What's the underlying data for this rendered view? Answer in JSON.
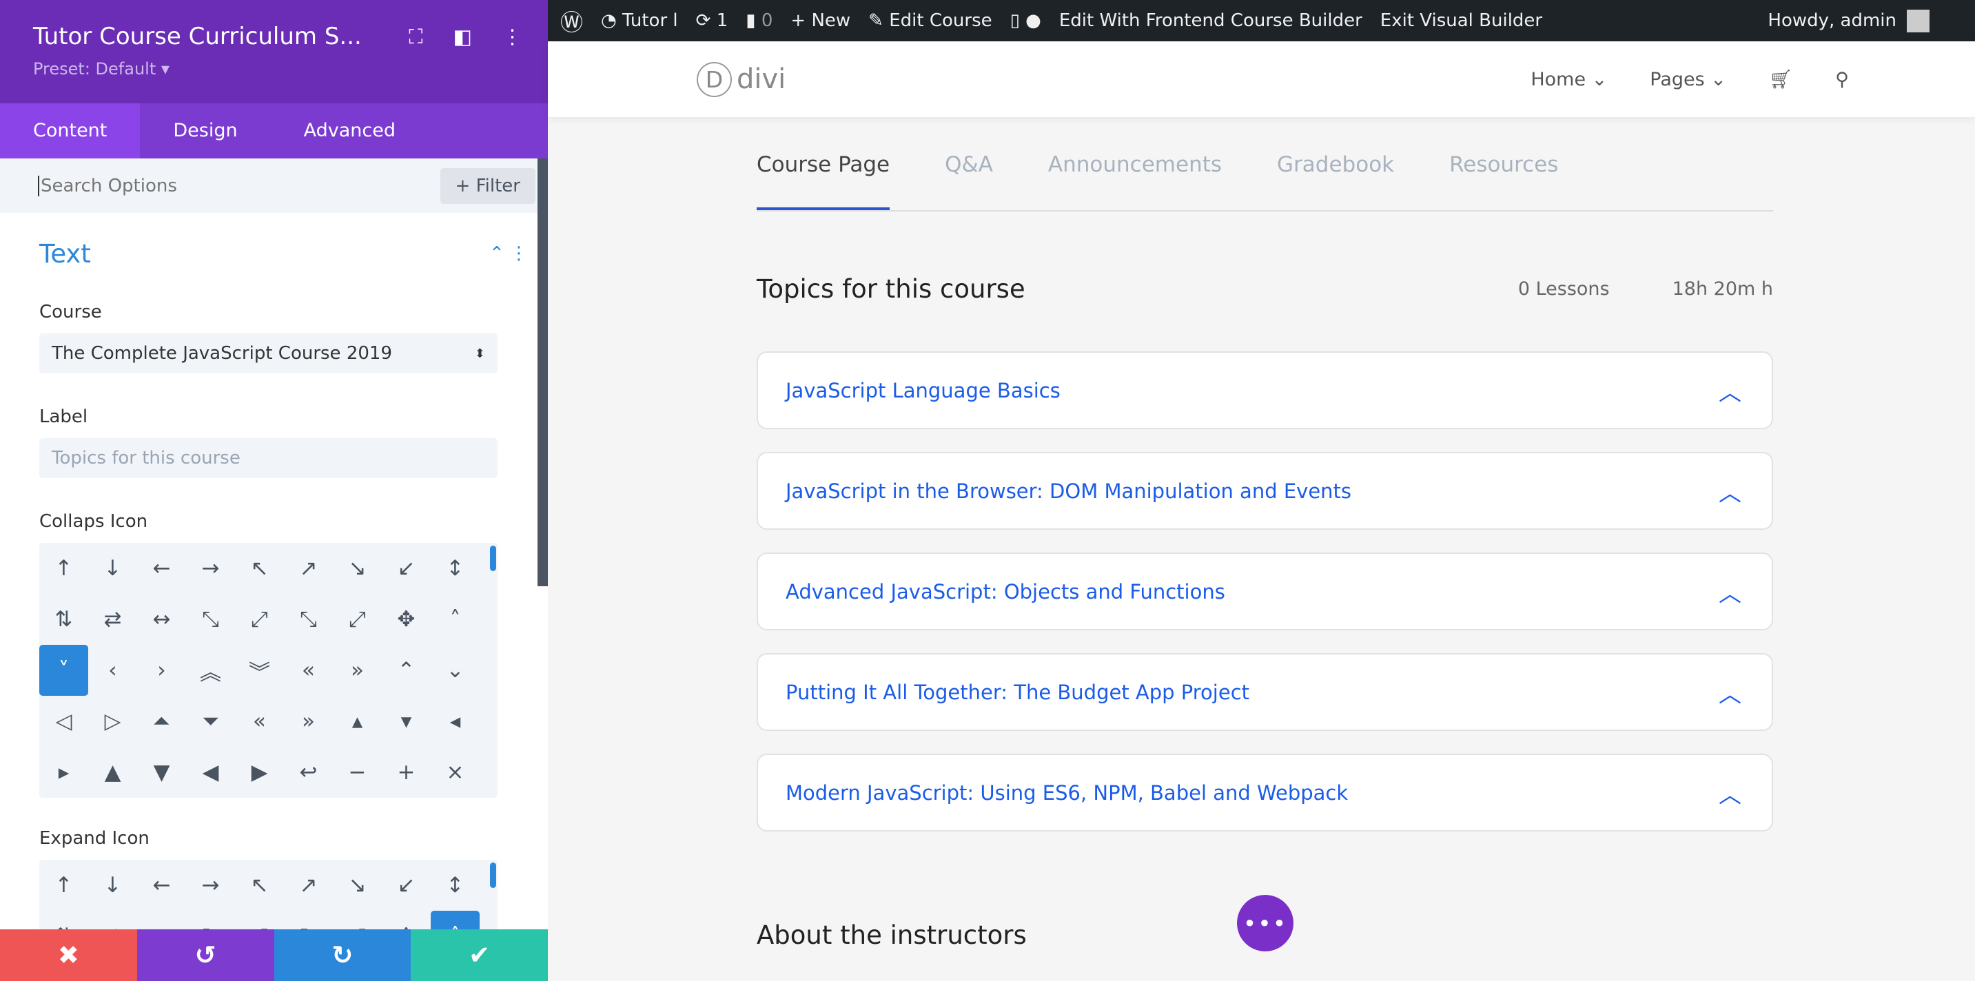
{
  "panel": {
    "title": "Tutor Course Curriculum S...",
    "preset": "Preset: Default ▾",
    "tabs": [
      "Content",
      "Design",
      "Advanced"
    ],
    "search_placeholder": "Search Options",
    "filter": "+ Filter",
    "section": "Text",
    "course_label": "Course",
    "course_value": "The Complete JavaScript Course 2019",
    "label_label": "Label",
    "label_placeholder": "Topics for this course",
    "collapse_label": "Collaps Icon",
    "expand_label": "Expand Icon",
    "icons": [
      "↑",
      "↓",
      "←",
      "→",
      "↖",
      "↗",
      "↘",
      "↙",
      "↕",
      "⇅",
      "⇄",
      "↔",
      "⤡",
      "⤢",
      "⤡",
      "⤢",
      "✥",
      "˄",
      "˅",
      "‹",
      "›",
      "︽",
      "︾",
      "«",
      "»",
      "⌃",
      "⌄",
      "◁",
      "▷",
      "⏶",
      "⏷",
      "«",
      "»",
      "▴",
      "▾",
      "◂",
      "▸",
      "▲",
      "▼",
      "◀",
      "▶",
      "↩",
      "−",
      "+",
      "×"
    ],
    "collapse_selected": 18,
    "expand_selected": 17,
    "footer": {
      "colors": {
        "cancel": "#ef5555",
        "undo": "#7e3bd0",
        "redo": "#2b87da",
        "save": "#29c4a9"
      }
    }
  },
  "wpbar": {
    "items": [
      "Tutor l",
      "1",
      "0",
      "+ New",
      "Edit Course",
      "Edit With Frontend Course Builder",
      "Exit Visual Builder"
    ],
    "greeting": "Howdy, admin"
  },
  "site": {
    "logo": "divi",
    "nav": [
      "Home ⌄",
      "Pages ⌄"
    ],
    "tabs": [
      "Course Page",
      "Q&A",
      "Announcements",
      "Gradebook",
      "Resources"
    ],
    "topics_title": "Topics for this course",
    "lessons": "0 Lessons",
    "duration": "18h 20m h",
    "topics": [
      "JavaScript Language Basics",
      "JavaScript in the Browser: DOM Manipulation and Events",
      "Advanced JavaScript: Objects and Functions",
      "Putting It All Together: The Budget App Project",
      "Modern JavaScript: Using ES6, NPM, Babel and Webpack"
    ],
    "about": "About the instructors",
    "accent": "#1a5ce8"
  }
}
